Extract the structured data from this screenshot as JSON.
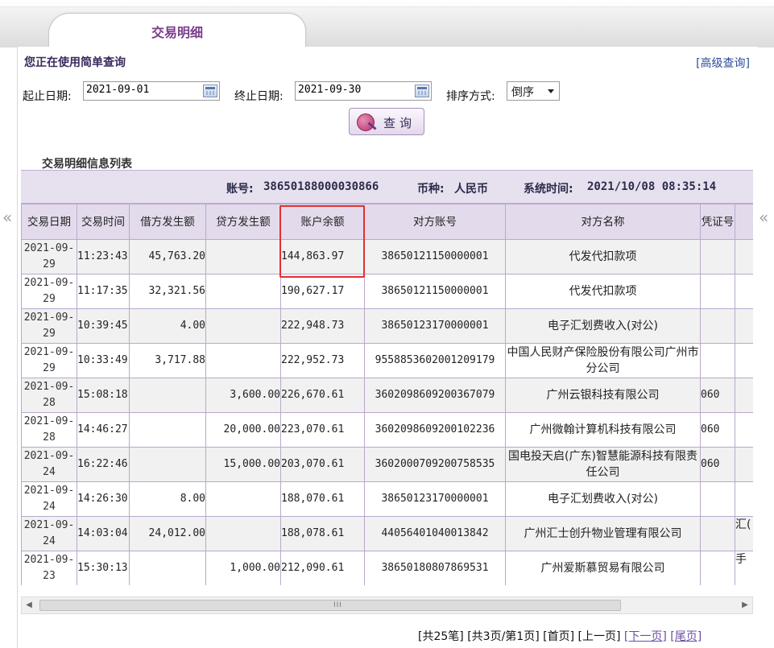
{
  "tab": {
    "title": "交易明细"
  },
  "query": {
    "section_title": "您正在使用简单查询",
    "advanced_link": "[高级查询]",
    "start_label": "起止日期:",
    "start_value": "2021-09-01",
    "end_label": "终止日期:",
    "end_value": "2021-09-30",
    "sort_label": "排序方式:",
    "sort_value": "倒序",
    "button_label": "查询"
  },
  "list": {
    "title": "交易明细信息列表",
    "account_label": "账号:",
    "account_value": "38650188000030866",
    "currency_label": "币种:",
    "currency_value": "人民币",
    "systime_label": "系统时间:",
    "systime_value": "2021/10/08 08:35:14"
  },
  "table": {
    "columns": [
      "交易日期",
      "交易时间",
      "借方发生额",
      "贷方发生额",
      "账户余额",
      "对方账号",
      "对方名称",
      "凭证号",
      ""
    ],
    "rows": [
      {
        "date": "2021-09-29",
        "time": "11:23:43",
        "debit": "45,763.20",
        "credit": "",
        "balance": "144,863.97",
        "acct": "38650121150000001",
        "name": "代发代扣款项",
        "voucher": "",
        "extra": ""
      },
      {
        "date": "2021-09-29",
        "time": "11:17:35",
        "debit": "32,321.56",
        "credit": "",
        "balance": "190,627.17",
        "acct": "38650121150000001",
        "name": "代发代扣款项",
        "voucher": "",
        "extra": ""
      },
      {
        "date": "2021-09-29",
        "time": "10:39:45",
        "debit": "4.00",
        "credit": "",
        "balance": "222,948.73",
        "acct": "38650123170000001",
        "name": "电子汇划费收入(对公)",
        "voucher": "",
        "extra": ""
      },
      {
        "date": "2021-09-29",
        "time": "10:33:49",
        "debit": "3,717.88",
        "credit": "",
        "balance": "222,952.73",
        "acct": "9558853602001209179",
        "name": "中国人民财产保险股份有限公司广州市分公司",
        "voucher": "",
        "extra": ""
      },
      {
        "date": "2021-09-28",
        "time": "15:08:18",
        "debit": "",
        "credit": "3,600.00",
        "balance": "226,670.61",
        "acct": "3602098609200367079",
        "name": "广州云银科技有限公司",
        "voucher": "060",
        "extra": ""
      },
      {
        "date": "2021-09-28",
        "time": "14:46:27",
        "debit": "",
        "credit": "20,000.00",
        "balance": "223,070.61",
        "acct": "3602098609200102236",
        "name": "广州微翰计算机科技有限公司",
        "voucher": "060",
        "extra": ""
      },
      {
        "date": "2021-09-24",
        "time": "16:22:46",
        "debit": "",
        "credit": "15,000.00",
        "balance": "203,070.61",
        "acct": "3602000709200758535",
        "name": "国电投天启(广东)智慧能源科技有限责任公司",
        "voucher": "060",
        "extra": ""
      },
      {
        "date": "2021-09-24",
        "time": "14:26:30",
        "debit": "8.00",
        "credit": "",
        "balance": "188,070.61",
        "acct": "38650123170000001",
        "name": "电子汇划费收入(对公)",
        "voucher": "",
        "extra": ""
      },
      {
        "date": "2021-09-24",
        "time": "14:03:04",
        "debit": "24,012.00",
        "credit": "",
        "balance": "188,078.61",
        "acct": "44056401040013842",
        "name": "广州汇士创升物业管理有限公司",
        "voucher": "",
        "extra": "汇("
      },
      {
        "date": "2021-09-23",
        "time": "15:30:13",
        "debit": "",
        "credit": "1,000.00",
        "balance": "212,090.61",
        "acct": "38650180807869531",
        "name": "广州爱斯慕贸易有限公司",
        "voucher": "",
        "extra": "手"
      }
    ]
  },
  "pager": {
    "total_records": "[共25笔]",
    "page_info": "[共3页/第1页]",
    "first": "[首页]",
    "prev": "[上一页]",
    "next": "[下一页]",
    "last": "[尾页]"
  },
  "icons": {
    "left_nav": "double-chevron-left-icon",
    "right_nav": "double-chevron-left-icon",
    "calendar": "calendar-icon",
    "search": "globe-search-icon"
  },
  "colors": {
    "header_bg": "#e3dbec",
    "grid_border": "#b9a8cc",
    "tab_text": "#7a3c8c",
    "highlight": "#e03030"
  }
}
